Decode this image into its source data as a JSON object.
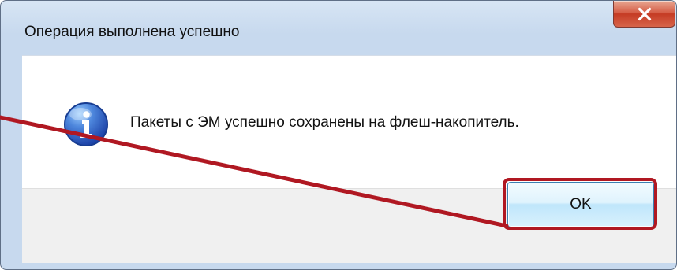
{
  "dialog": {
    "title": "Операция выполнена успешно",
    "message": "Пакеты с ЭМ успешно сохранены на флеш-накопитель.",
    "ok_label": "OK",
    "close_glyph": "X"
  },
  "icons": {
    "close": "close-icon",
    "info": "info-icon"
  },
  "colors": {
    "frame": "#c7d9ee",
    "close_button": "#d65f48",
    "ok_button_border": "#3c7fb1",
    "highlight": "#b01822",
    "client_background": "#ffffff",
    "button_bar": "#f0f0f0",
    "info_icon": "#3b6bc6"
  }
}
